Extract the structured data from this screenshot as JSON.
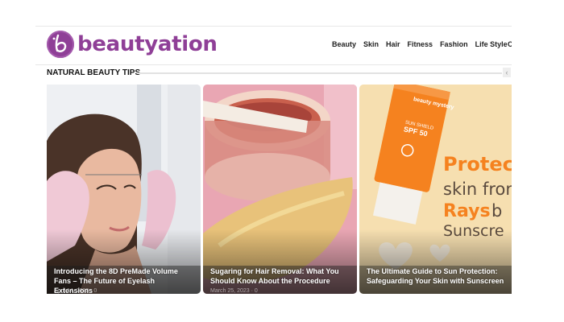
{
  "brand": {
    "name": "beautyation"
  },
  "nav": {
    "items": [
      "Beauty",
      "Skin",
      "Hair",
      "Fitness",
      "Fashion",
      "Life Style"
    ],
    "cut_item": "C"
  },
  "section": {
    "title": "NATURAL BEAUTY TIPS",
    "arrow_icon": "chevron-left-icon"
  },
  "colors": {
    "brand": "#8f3f97",
    "sunscreen_orange": "#f5821f",
    "card3_bg": "#f6dfb0"
  },
  "cards": [
    {
      "title": "Introducing the 8D PreMade Volume Fans – The Future of Eyelash Extensions",
      "meta": "April 14, 2023 · 0"
    },
    {
      "title": "Sugaring for Hair Removal: What You Should Know About the Procedure",
      "meta": "March 25, 2023 · 0"
    },
    {
      "title": "The Ultimate Guide to Sun Protection: Safeguarding Your Skin with Sunscreen",
      "meta": "",
      "image_text": {
        "tube_brand": "beauty mystery",
        "tube_spf": "SPF 50",
        "tube_small": "SUN SHIELD",
        "line1": "Protec",
        "line2": "skin fron",
        "line3a": "Rays",
        "line3b": " b",
        "line4": "Sunscre"
      }
    }
  ]
}
